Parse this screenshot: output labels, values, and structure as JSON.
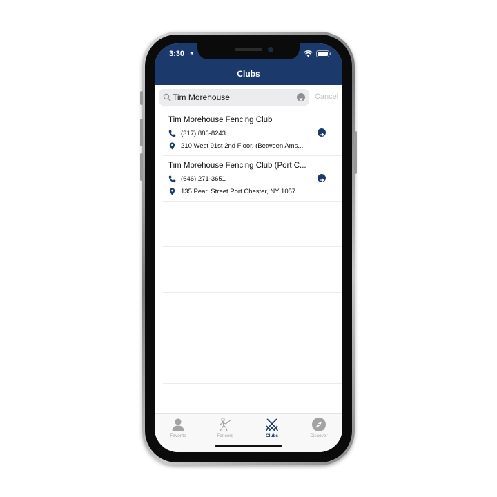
{
  "status_bar": {
    "time": "3:30"
  },
  "header": {
    "title": "Clubs"
  },
  "search": {
    "value": "Tim Morehouse",
    "cancel_label": "Cancel"
  },
  "clubs": [
    {
      "name": "Tim Morehouse Fencing Club",
      "phone": "(317) 886-8243",
      "address": "210 West 91st 2nd Floor, (Between Ams..."
    },
    {
      "name": "Tim Morehouse Fencing Club (Port C...",
      "phone": "(646) 271-3651",
      "address": "135 Pearl Street Port Chester, NY 1057..."
    }
  ],
  "tabs": [
    {
      "label": "Favorite",
      "icon": "person-icon",
      "active": false
    },
    {
      "label": "Fencers",
      "icon": "fencer-icon",
      "active": false
    },
    {
      "label": "Clubs",
      "icon": "crossed-swords-icon",
      "active": true
    },
    {
      "label": "Discover",
      "icon": "compass-icon",
      "active": false
    }
  ],
  "colors": {
    "brand": "#1b3a6b",
    "inactive_tab": "#a3a3a3",
    "cancel": "#c2c2c6"
  }
}
